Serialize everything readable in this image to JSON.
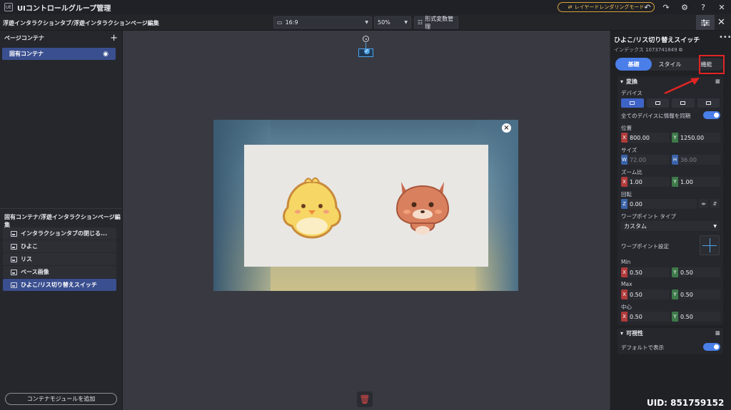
{
  "app": {
    "logo": "UE",
    "title": "UIコントロールグループ管理",
    "render_mode": "レイヤードレンダリングモード",
    "icons": [
      "undo-icon",
      "redo-icon",
      "gear-icon",
      "help-icon",
      "close-icon"
    ]
  },
  "toolbar": {
    "breadcrumb": "浮遊インタラクションタブ/浮遊インタラクションページ編集",
    "aspect": "16:9",
    "zoom": "50%",
    "format_vars": "形式変数管理"
  },
  "left_panel": {
    "page_contents_title": "ページコンテナ",
    "container_item": "固有コンテナ",
    "sub_title": "固有コンテナ/浮遊インタラクションページ編集",
    "items": [
      {
        "label": "インタラクションタブの閉じる..."
      },
      {
        "label": "ひよこ"
      },
      {
        "label": "リス"
      },
      {
        "label": "ベース画像"
      },
      {
        "label": "ひよこ/リス切り替えスイッチ"
      }
    ],
    "add_module": "コンテナモジュールを追加"
  },
  "right_panel": {
    "title": "ひよこ/リス切り替えスイッチ",
    "index_label": "インデックス",
    "index_value": "1073741849",
    "tabs": [
      "基礎",
      "スタイル",
      "機能"
    ],
    "transform": {
      "title": "変換",
      "device_label": "デバイス",
      "sync_label": "全てのデバイスに情報を同期",
      "position_label": "位置",
      "pos_x": "800.00",
      "pos_y": "1250.00",
      "size_label": "サイズ",
      "size_w": "72.00",
      "size_h": "36.00",
      "zoom_label": "ズーム比",
      "zoom_x": "1.00",
      "zoom_y": "1.00",
      "rotation_label": "回転",
      "rot_z": "0.00",
      "warp_type_label": "ワープポイント タイプ",
      "warp_type_value": "カスタム",
      "warp_setting_label": "ワープポイント設定",
      "min_label": "Min",
      "min_x": "0.50",
      "min_y": "0.50",
      "max_label": "Max",
      "max_x": "0.50",
      "max_y": "0.50",
      "center_label": "中心",
      "center_x": "0.50",
      "center_y": "0.50",
      "axis_x": "X",
      "axis_y": "Y",
      "axis_z": "Z",
      "axis_w": "W",
      "axis_h": "H"
    },
    "visibility": {
      "title": "可視性",
      "default_label": "デフォルトで表示"
    }
  },
  "uid": "UID: 851759152",
  "colors": {
    "accent": "#4a7ee8",
    "highlight": "#e22424",
    "selected_item": "#3a4f8f"
  }
}
